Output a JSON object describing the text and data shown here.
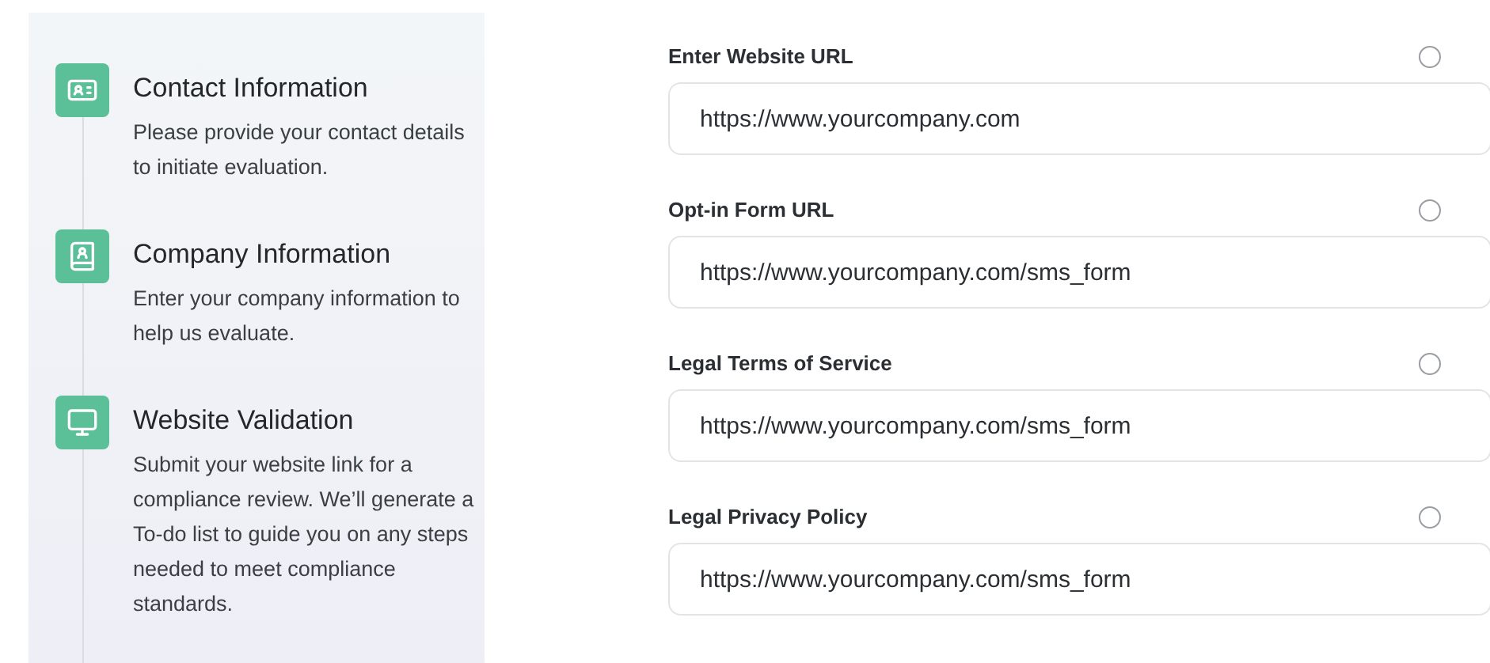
{
  "steps": [
    {
      "title": "Contact Information",
      "description": "Please provide your contact details to initiate evaluation."
    },
    {
      "title": "Company Information",
      "description": "Enter your company information to help us evaluate."
    },
    {
      "title": "Website Validation",
      "description": "Submit your website link for a compliance review. We’ll generate a To-do list to guide you on any steps needed to meet compliance standards."
    }
  ],
  "fields": [
    {
      "label": "Enter Website URL",
      "value": "https://www.yourcompany.com"
    },
    {
      "label": "Opt-in Form URL",
      "value": "https://www.yourcompany.com/sms_form"
    },
    {
      "label": "Legal Terms of Service",
      "value": "https://www.yourcompany.com/sms_form"
    },
    {
      "label": "Legal Privacy Policy",
      "value": "https://www.yourcompany.com/sms_form"
    }
  ]
}
